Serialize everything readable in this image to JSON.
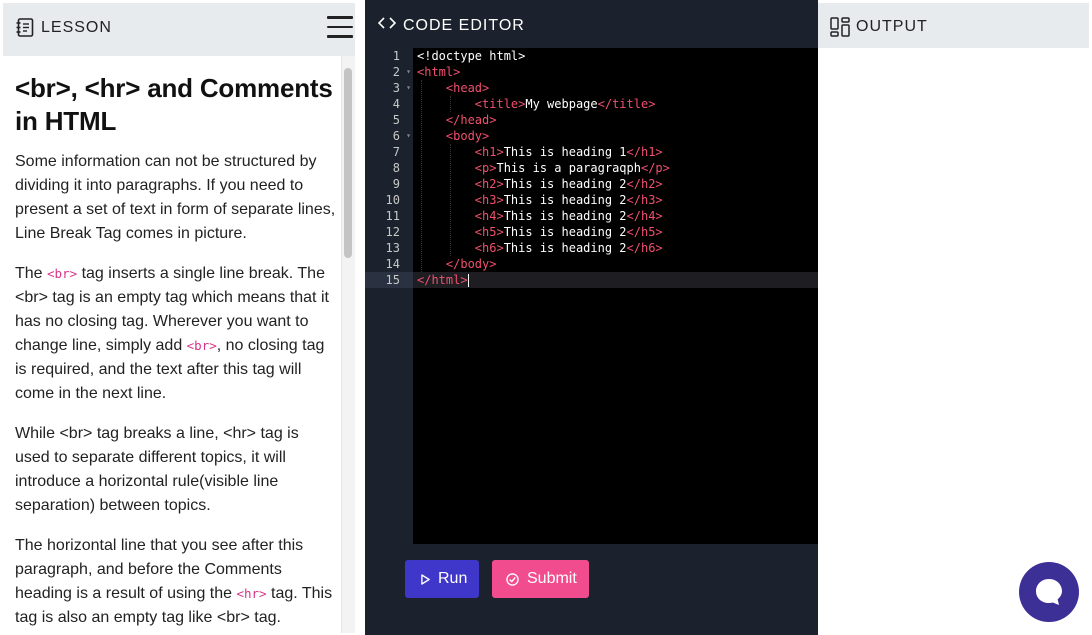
{
  "lesson": {
    "header_title": "LESSON",
    "title": "<br>, <hr> and Comments in HTML",
    "p1": "Some information can not be structured by dividing it into paragraphs. If you need to present a set of text in form of separate lines, Line Break Tag comes in picture.",
    "p2_a": "The ",
    "p2_code1": "<br>",
    "p2_b": " tag inserts a single line break. The <br> tag is an empty tag which means that it has no closing tag. Wherever you want to change line, simply add ",
    "p2_code2": "<br>",
    "p2_c": ", no closing tag is required, and the text after this tag will come in the next line.",
    "p3": "While <br> tag breaks a line, <hr> tag is used to separate different topics, it will introduce a horizontal rule(visible line separation) between topics.",
    "p4_a": "The horizontal line that you see after this paragraph, and before the Comments heading is a result of using the ",
    "p4_code": "<hr>",
    "p4_b": " tag. This tag is also an empty tag like <br> tag."
  },
  "editor": {
    "header_title": "CODE EDITOR",
    "line_numbers": [
      "1",
      "2",
      "3",
      "4",
      "5",
      "6",
      "7",
      "8",
      "9",
      "10",
      "11",
      "12",
      "13",
      "14",
      "15"
    ],
    "lines": [
      {
        "indent": "",
        "parts": [
          [
            "txt",
            "<!doctype html>"
          ]
        ]
      },
      {
        "indent": "",
        "parts": [
          [
            "tag",
            "<html>"
          ]
        ]
      },
      {
        "indent": "    ",
        "parts": [
          [
            "tag",
            "<head>"
          ]
        ]
      },
      {
        "indent": "        ",
        "parts": [
          [
            "tag",
            "<title>"
          ],
          [
            "txt",
            "My webpage"
          ],
          [
            "tag",
            "</title>"
          ]
        ]
      },
      {
        "indent": "    ",
        "parts": [
          [
            "tag",
            "</head>"
          ]
        ]
      },
      {
        "indent": "    ",
        "parts": [
          [
            "tag",
            "<body>"
          ]
        ]
      },
      {
        "indent": "        ",
        "parts": [
          [
            "tag",
            "<h1>"
          ],
          [
            "txt",
            "This is heading 1"
          ],
          [
            "tag",
            "</h1>"
          ]
        ]
      },
      {
        "indent": "        ",
        "parts": [
          [
            "tag",
            "<p>"
          ],
          [
            "txt",
            "This is a paragraqph"
          ],
          [
            "tag",
            "</p>"
          ]
        ]
      },
      {
        "indent": "        ",
        "parts": [
          [
            "tag",
            "<h2>"
          ],
          [
            "txt",
            "This is heading 2"
          ],
          [
            "tag",
            "</h2>"
          ]
        ]
      },
      {
        "indent": "        ",
        "parts": [
          [
            "tag",
            "<h3>"
          ],
          [
            "txt",
            "This is heading 2"
          ],
          [
            "tag",
            "</h3>"
          ]
        ]
      },
      {
        "indent": "        ",
        "parts": [
          [
            "tag",
            "<h4>"
          ],
          [
            "txt",
            "This is heading 2"
          ],
          [
            "tag",
            "</h4>"
          ]
        ]
      },
      {
        "indent": "        ",
        "parts": [
          [
            "tag",
            "<h5>"
          ],
          [
            "txt",
            "This is heading 2"
          ],
          [
            "tag",
            "</h5>"
          ]
        ]
      },
      {
        "indent": "        ",
        "parts": [
          [
            "tag",
            "<h6>"
          ],
          [
            "txt",
            "This is heading 2"
          ],
          [
            "tag",
            "</h6>"
          ]
        ]
      },
      {
        "indent": "    ",
        "parts": [
          [
            "tag",
            "</body>"
          ]
        ]
      },
      {
        "indent": "",
        "parts": [
          [
            "tag",
            "</html>"
          ]
        ]
      }
    ],
    "run_label": "Run",
    "submit_label": "Submit"
  },
  "output": {
    "header_title": "OUTPUT"
  },
  "colors": {
    "tag": "#f0506e",
    "run_button": "#3f37c9",
    "submit_button": "#f14d8e",
    "chat_button": "#3c3096",
    "editor_bg": "#1b222d"
  },
  "icons": {
    "lesson": "notebook-icon",
    "menu": "hamburger-menu-icon",
    "editor": "code-brackets-icon",
    "output": "layout-panels-icon",
    "run": "play-icon",
    "submit": "check-circle-icon",
    "chat": "chat-bubble-icon"
  }
}
